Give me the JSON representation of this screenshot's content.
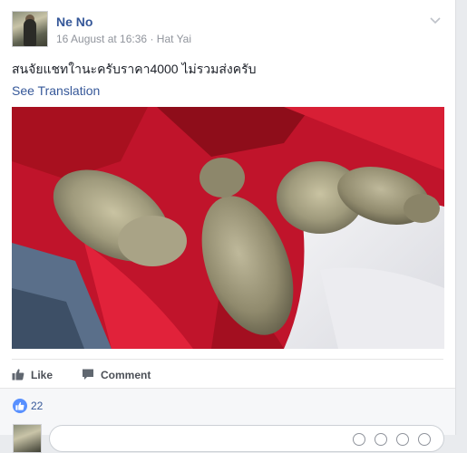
{
  "post": {
    "author": "Ne No",
    "date": "16 August at 16:36",
    "separator": "·",
    "location": "Hat Yai",
    "text": "สนจัยแชทใานะครับราคา4000 ไม่รวมส่งครับ",
    "see_translation": "See Translation"
  },
  "actions": {
    "like_label": "Like",
    "comment_label": "Comment"
  },
  "reactions": {
    "like_count": "22"
  },
  "colors": {
    "link": "#365899",
    "like_badge": "#5890ff",
    "muted": "#90949c"
  },
  "icons": {
    "menu": "chevron-down-icon",
    "like": "thumbs-up-icon",
    "comment": "speech-bubble-icon"
  }
}
